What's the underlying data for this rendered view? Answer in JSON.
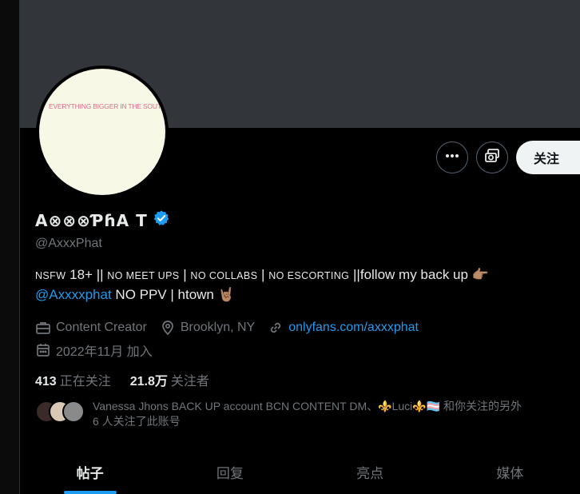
{
  "banner": {
    "color": "#323539"
  },
  "avatar": {
    "text": "EVERYTHING BIGGER IN THE SOUTH"
  },
  "actions": {
    "more_icon": "more-horizontal-icon",
    "subscribe_icon": "money-icon",
    "follow_label": "关注"
  },
  "profile": {
    "display_name": "A⊗⊗⊗ƤɦA T",
    "verified_icon": "verified-badge-icon",
    "handle": "@AxxxPhat"
  },
  "bio": {
    "part1_caps": "NSFW",
    "part1_num": " 18+ || ",
    "part2_caps": "NO MEET UPS",
    "sep1": " | ",
    "part3_caps": "NO COLLABS",
    "sep2": " | ",
    "part4_caps": "NO ESCORTING",
    "part5": " ||follow my back up 👉🏽",
    "mention": "@Axxxxphat",
    "part6": " NO PPV | htown 🤘🏽"
  },
  "meta": {
    "category": "Content Creator",
    "location": "Brooklyn, NY",
    "website": "onlyfans.com/axxxphat",
    "joined": "2022年11月 加入"
  },
  "counts": {
    "following_num": "413",
    "following_label": "正在关注",
    "followers_num": "21.8万",
    "followers_label": "关注者"
  },
  "followed_by": {
    "line1": "Vanessa Jhons BACK UP account BCN CONTENT DM、⚜️Luci⚜️🏳️‍⚧️ 和你关注的另外",
    "line2": "6 人关注了此账号"
  },
  "tabs": [
    {
      "label": "帖子"
    },
    {
      "label": "回复"
    },
    {
      "label": "亮点"
    },
    {
      "label": "媒体"
    }
  ],
  "colors": {
    "accent": "#1d9bf0",
    "muted": "#71767b",
    "text": "#e7e9ea"
  }
}
